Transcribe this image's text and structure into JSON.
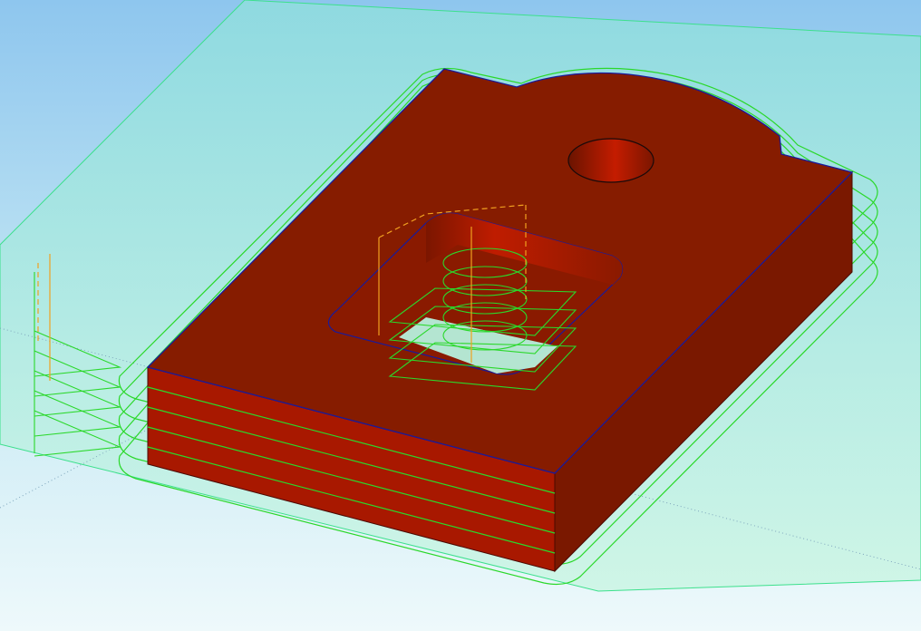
{
  "colors": {
    "background_top": "#8ec6ee",
    "background_bottom": "#eaf7fb",
    "work_plane": "#a8ecd8",
    "work_plane_edge": "#3ce08c",
    "part_top": "#841c00",
    "part_side": "#a61800",
    "part_side_dark": "#741800",
    "part_edge": "#1a1a9a",
    "toolpath": "#2bd82b",
    "lead_move": "#f0a020",
    "rapid_move": "#f0a020",
    "axis_dotted": "#7aa0b8"
  },
  "icons": [
    "stock-part",
    "roughing-toolpath",
    "pocket-toolpath",
    "helical-entry",
    "lead-in-moves",
    "work-plane"
  ]
}
